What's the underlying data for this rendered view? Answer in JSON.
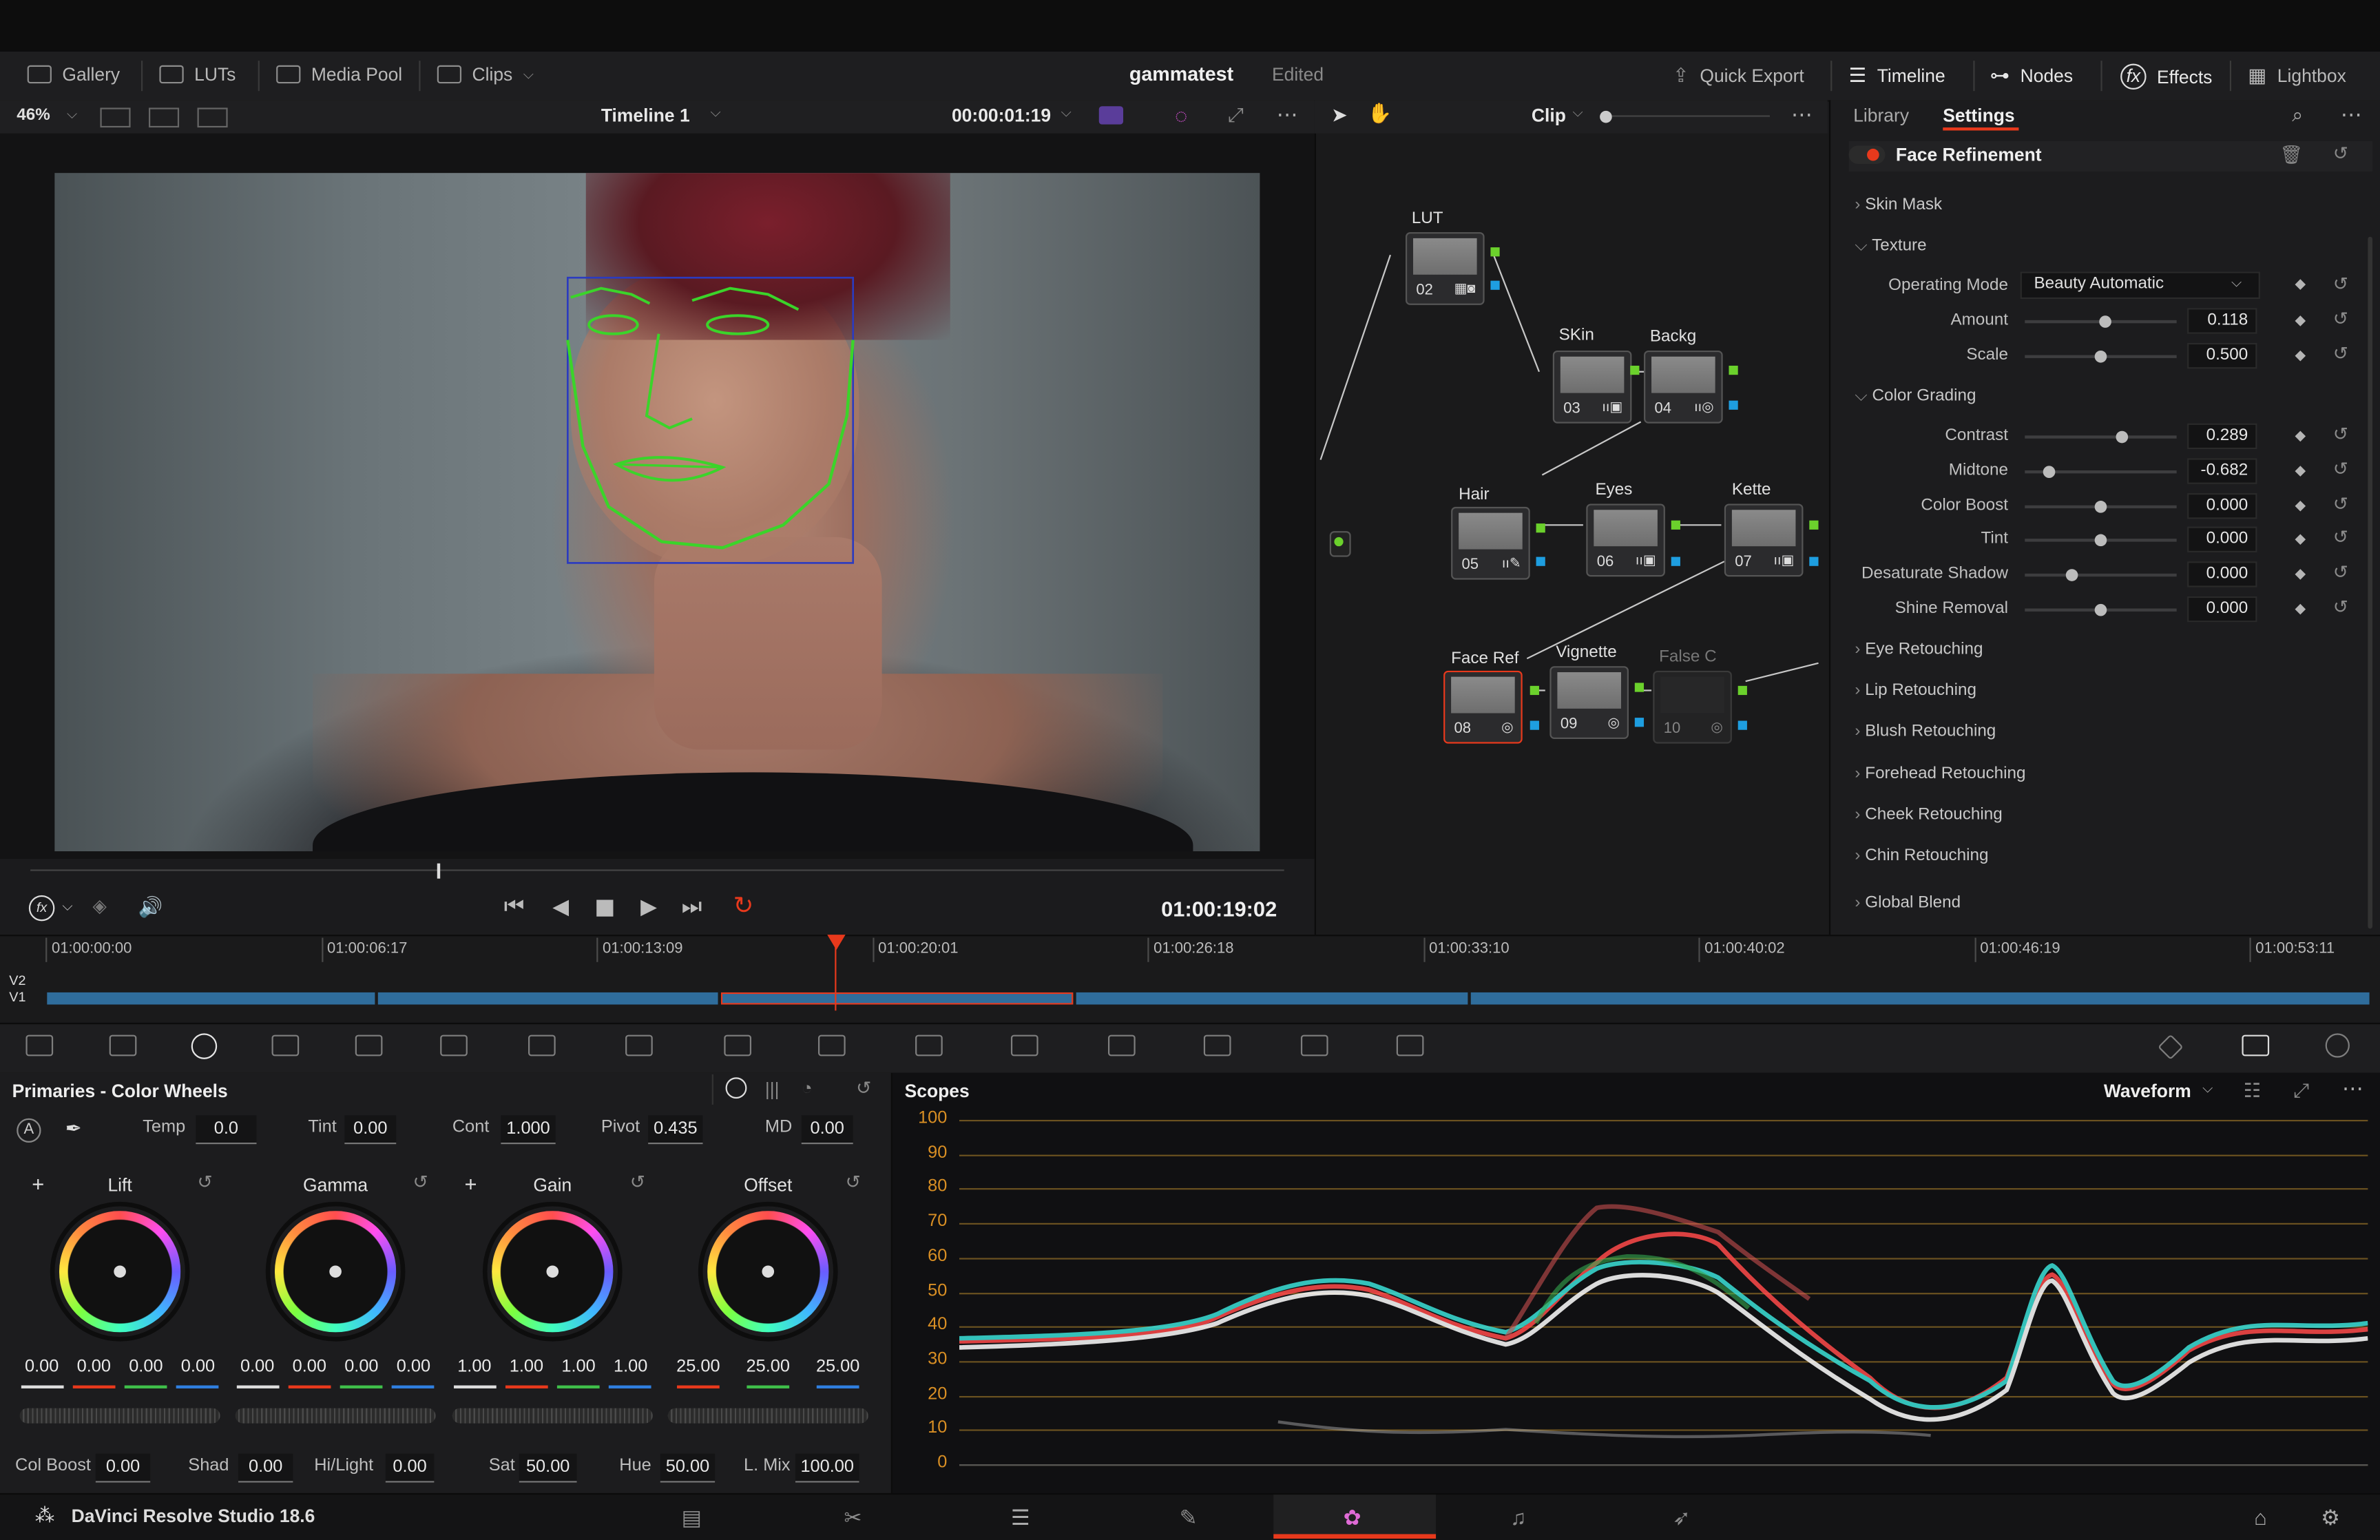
{
  "app": {
    "name": "DaVinci Resolve Studio 18.6",
    "project": "gammatest",
    "status": "Edited"
  },
  "menu_left": [
    {
      "id": "gallery",
      "label": "Gallery"
    },
    {
      "id": "luts",
      "label": "LUTs"
    },
    {
      "id": "media_pool",
      "label": "Media Pool"
    },
    {
      "id": "clips",
      "label": "Clips"
    }
  ],
  "menu_right": [
    {
      "id": "quick_export",
      "label": "Quick Export"
    },
    {
      "id": "timeline",
      "label": "Timeline"
    },
    {
      "id": "nodes",
      "label": "Nodes"
    },
    {
      "id": "effects",
      "label": "Effects"
    },
    {
      "id": "lightbox",
      "label": "Lightbox"
    }
  ],
  "viewer": {
    "zoom": "46%",
    "timeline_name": "Timeline 1",
    "source_timecode": "00:00:01:19",
    "record_timecode": "01:00:19:02"
  },
  "nodes_panel": {
    "mode": "Clip",
    "nodes": [
      {
        "label": "LUT",
        "num": "02"
      },
      {
        "label": "SKin",
        "num": "03"
      },
      {
        "label": "Backg",
        "num": "04"
      },
      {
        "label": "Hair",
        "num": "05"
      },
      {
        "label": "Eyes",
        "num": "06"
      },
      {
        "label": "Kette",
        "num": "07"
      },
      {
        "label": "Face Ref",
        "num": "08"
      },
      {
        "label": "Vignette",
        "num": "09"
      },
      {
        "label": "False C",
        "num": "10"
      }
    ]
  },
  "inspector": {
    "tabs": [
      "Library",
      "Settings"
    ],
    "effect_name": "Face Refinement",
    "skin_mask": "Skin Mask",
    "texture": "Texture",
    "operating_mode_label": "Operating Mode",
    "operating_mode_value": "Beauty Automatic",
    "texture_params": [
      {
        "label": "Amount",
        "value": "0.118",
        "pos": 0.53
      },
      {
        "label": "Scale",
        "value": "0.500",
        "pos": 0.5
      }
    ],
    "color_grading": "Color Grading",
    "grading_params": [
      {
        "label": "Contrast",
        "value": "0.289",
        "pos": 0.64
      },
      {
        "label": "Midtone",
        "value": "-0.682",
        "pos": 0.16
      },
      {
        "label": "Color Boost",
        "value": "0.000",
        "pos": 0.5
      },
      {
        "label": "Tint",
        "value": "0.000",
        "pos": 0.5
      },
      {
        "label": "Desaturate Shadow",
        "value": "0.000",
        "pos": 0.31
      },
      {
        "label": "Shine Removal",
        "value": "0.000",
        "pos": 0.5
      }
    ],
    "sections": [
      "Eye Retouching",
      "Lip Retouching",
      "Blush Retouching",
      "Forehead Retouching",
      "Cheek Retouching",
      "Chin Retouching",
      "Global Blend"
    ]
  },
  "timeline": {
    "track_labels": [
      "V2",
      "V1"
    ],
    "timecodes": [
      "01:00:00:00",
      "01:00:06:17",
      "01:00:13:09",
      "01:00:20:01",
      "01:00:26:18",
      "01:00:33:10",
      "01:00:40:02",
      "01:00:46:19",
      "01:00:53:11"
    ]
  },
  "primaries": {
    "title": "Primaries - Color Wheels",
    "auto_label": "A",
    "top_params": [
      {
        "label": "Temp",
        "value": "0.0"
      },
      {
        "label": "Tint",
        "value": "0.00"
      },
      {
        "label": "Cont",
        "value": "1.000"
      },
      {
        "label": "Pivot",
        "value": "0.435"
      },
      {
        "label": "MD",
        "value": "0.00"
      }
    ],
    "wheels": [
      {
        "name": "Lift",
        "values": [
          "0.00",
          "0.00",
          "0.00",
          "0.00"
        ]
      },
      {
        "name": "Gamma",
        "values": [
          "0.00",
          "0.00",
          "0.00",
          "0.00"
        ]
      },
      {
        "name": "Gain",
        "values": [
          "1.00",
          "1.00",
          "1.00",
          "1.00"
        ]
      },
      {
        "name": "Offset",
        "values": [
          "25.00",
          "25.00",
          "25.00"
        ]
      }
    ],
    "bottom_params": [
      {
        "label": "Col Boost",
        "value": "0.00"
      },
      {
        "label": "Shad",
        "value": "0.00"
      },
      {
        "label": "Hi/Light",
        "value": "0.00"
      },
      {
        "label": "Sat",
        "value": "50.00"
      },
      {
        "label": "Hue",
        "value": "50.00"
      },
      {
        "label": "L. Mix",
        "value": "100.00"
      }
    ]
  },
  "scopes": {
    "title": "Scopes",
    "mode": "Waveform",
    "scale": [
      "100",
      "90",
      "80",
      "70",
      "60",
      "50",
      "40",
      "30",
      "20",
      "10",
      "0"
    ]
  },
  "colors": {
    "accent_red": "#e8391c",
    "node_green": "#6bd12c",
    "node_blue": "#1e9ee0",
    "scope_grid": "#d98f24"
  }
}
